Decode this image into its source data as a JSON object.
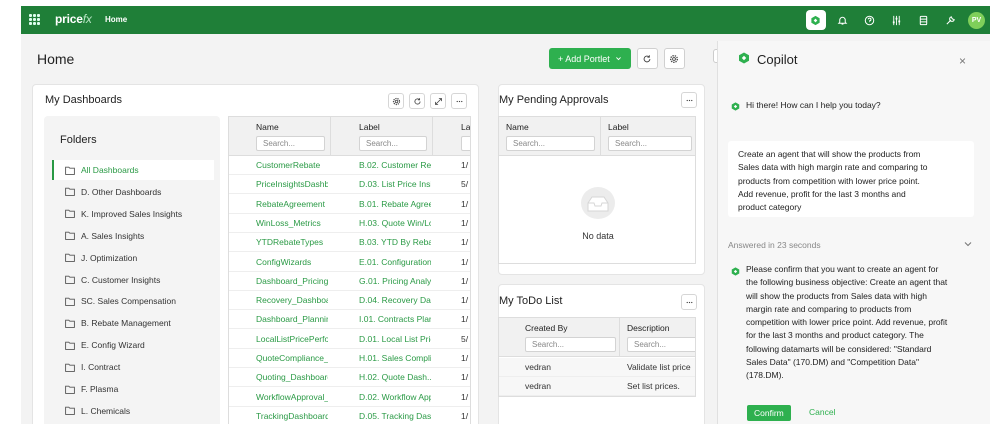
{
  "topbar": {
    "logo_main": "price",
    "logo_accent": "fx",
    "title": "Home",
    "avatar": "PV",
    "icons": [
      "copilot-icon",
      "bell-icon",
      "help-icon",
      "sliders-icon",
      "database-icon",
      "tools-icon"
    ]
  },
  "page": {
    "title": "Home",
    "add_portlet": "+ Add Portlet"
  },
  "dashboards": {
    "title": "My Dashboards",
    "folders_title": "Folders",
    "folders": [
      "All Dashboards",
      "D. Other Dashboards",
      "K. Improved Sales Insights",
      "A. Sales Insights",
      "J. Optimization",
      "C. Customer Insights",
      "SC. Sales Compensation",
      "B. Rebate Management",
      "E. Config Wizard",
      "I. Contract",
      "F. Plasma",
      "L. Chemicals"
    ],
    "columns": [
      "Name",
      "Label",
      "La"
    ],
    "search_placeholder": "Search...",
    "rows": [
      [
        "CustomerRebate",
        "B.02. Customer Reb...",
        "1/"
      ],
      [
        "PriceInsightsDashb...",
        "D.03. List Price Insi...",
        "5/"
      ],
      [
        "RebateAgreement",
        "B.01. Rebate Agree...",
        "1/"
      ],
      [
        "WinLoss_Metrics",
        "H.03. Quote Win/Lo...",
        "1/"
      ],
      [
        "YTDRebateTypes",
        "B.03. YTD By Rebat...",
        "1/"
      ],
      [
        "ConfigWizards",
        "E.01. Configuration ...",
        "1/"
      ],
      [
        "Dashboard_Pricing_...",
        "G.01. Pricing Analyst",
        "1/"
      ],
      [
        "Recovery_Dashboard",
        "D.04. Recovery Das...",
        "1/"
      ],
      [
        "Dashboard_Planning",
        "I.01. Contracts Plan...",
        "1/"
      ],
      [
        "LocalListPricePerfo...",
        "D.01. Local List Pric...",
        "5/"
      ],
      [
        "QuoteCompliance_...",
        "H.01. Sales Complia...",
        "1/"
      ],
      [
        "Quoting_Dashboard",
        "H.02. Quote Dash...",
        "1/"
      ],
      [
        "WorkflowApproval_...",
        "D.02. Workflow App...",
        "1/"
      ],
      [
        "TrackingDashboard",
        "D.05. Tracking Dash...",
        "1/"
      ]
    ]
  },
  "approvals": {
    "title": "My Pending Approvals",
    "columns": [
      "Name",
      "Label"
    ],
    "search_placeholder": "Search...",
    "empty": "No data"
  },
  "todo": {
    "title": "My ToDo List",
    "columns": [
      "Created By",
      "Description"
    ],
    "search_placeholder": "Search...",
    "rows": [
      [
        "vedran",
        "Validate list price"
      ],
      [
        "vedran",
        "Set list prices."
      ]
    ]
  },
  "copilot": {
    "title": "Copilot",
    "close": "×",
    "greeting": "Hi there! How can I help you today?",
    "user_message_lines": [
      "Create an agent that will show the products from",
      "Sales data with high margin rate and comparing to",
      "products from competition with lower price point.",
      "Add revenue, profit for the last 3 months and",
      "product category"
    ],
    "answered": "Answered in 23 seconds",
    "answer_lines": [
      "Please confirm that you want to create an agent for",
      "the following business objective: Create an agent that",
      "will show the products from Sales data with high",
      "margin rate and comparing to products from",
      "competition with lower price point. Add revenue, profit",
      "for the last 3 months and product category. The",
      "following datamarts will be considered: \"Standard",
      "Sales Data\" (170.DM) and \"Competition Data\"",
      "(178.DM)."
    ],
    "confirm": "Confirm",
    "cancel": "Cancel"
  },
  "colors": {
    "topbar": "#1f7f38",
    "accent": "#2eb04f",
    "link": "#2a9a45"
  }
}
